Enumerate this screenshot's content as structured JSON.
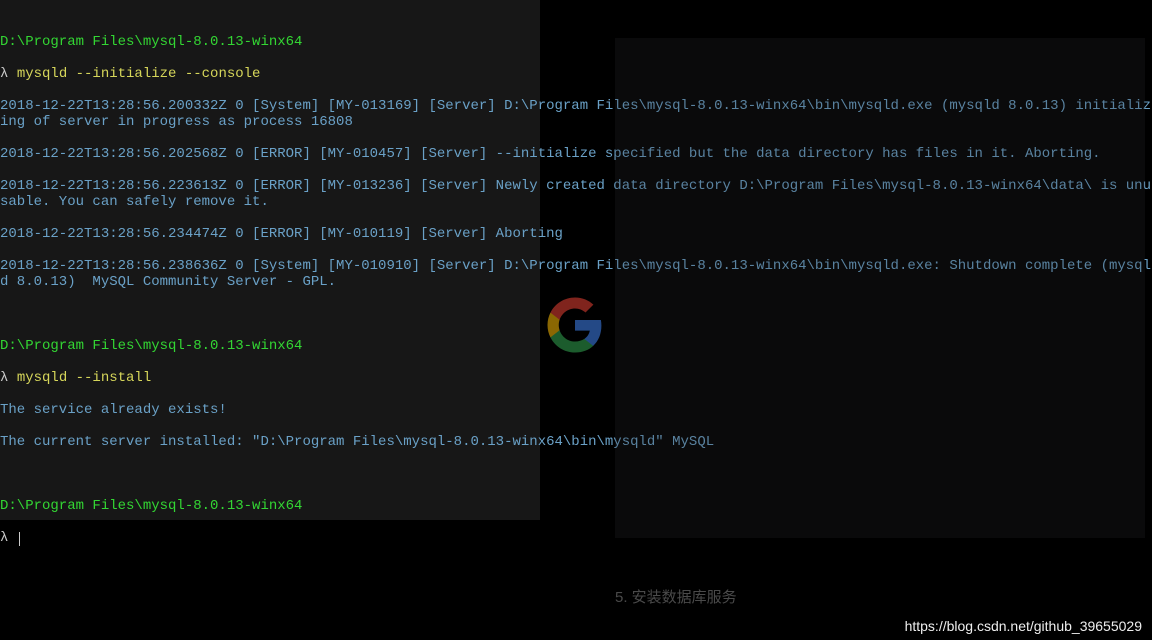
{
  "terminal": {
    "prompt1": {
      "path": "D:\\Program Files\\mysql-8.0.13-winx64",
      "lambda": "λ",
      "command": "mysqld --initialize --console"
    },
    "out1": "2018-12-22T13:28:56.200332Z 0 [System] [MY-013169] [Server] D:\\Program Files\\mysql-8.0.13-winx64\\bin\\mysqld.exe (mysqld 8.0.13) initializing of server in progress as process 16808",
    "out2": "2018-12-22T13:28:56.202568Z 0 [ERROR] [MY-010457] [Server] --initialize specified but the data directory has files in it. Aborting.",
    "out3": "2018-12-22T13:28:56.223613Z 0 [ERROR] [MY-013236] [Server] Newly created data directory D:\\Program Files\\mysql-8.0.13-winx64\\data\\ is unusable. You can safely remove it.",
    "out4": "2018-12-22T13:28:56.234474Z 0 [ERROR] [MY-010119] [Server] Aborting",
    "out5": "2018-12-22T13:28:56.238636Z 0 [System] [MY-010910] [Server] D:\\Program Files\\mysql-8.0.13-winx64\\bin\\mysqld.exe: Shutdown complete (mysqld 8.0.13)  MySQL Community Server - GPL.",
    "prompt2": {
      "path": "D:\\Program Files\\mysql-8.0.13-winx64",
      "lambda": "λ",
      "command": "mysqld --install"
    },
    "out6": "The service already exists!",
    "out7": "The current server installed: \"D:\\Program Files\\mysql-8.0.13-winx64\\bin\\mysqld\" MySQL",
    "prompt3": {
      "path": "D:\\Program Files\\mysql-8.0.13-winx64",
      "lambda": "λ"
    }
  },
  "footer": "5. 安装数据库服务",
  "watermark": "https://blog.csdn.net/github_39655029"
}
